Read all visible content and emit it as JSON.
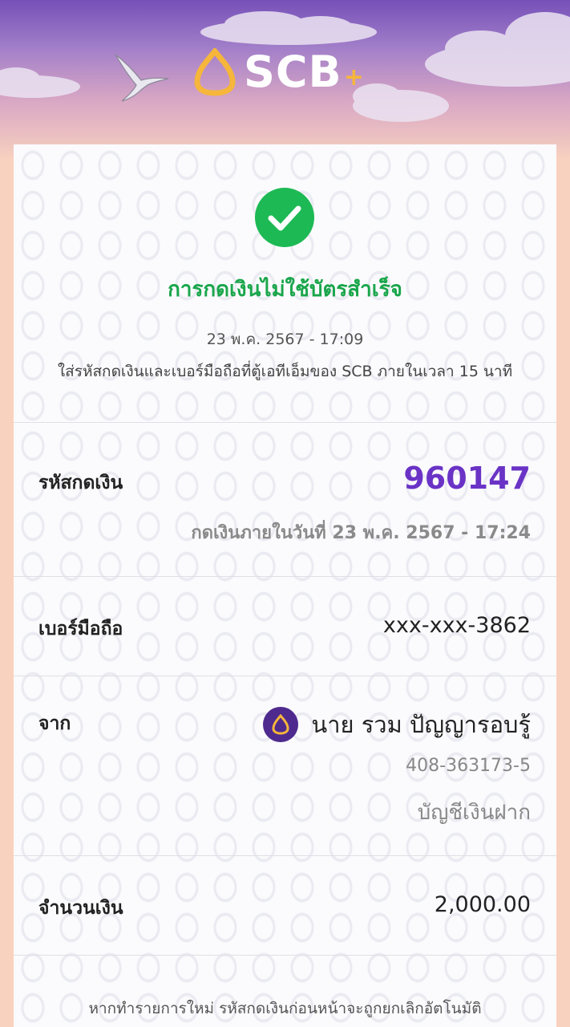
{
  "header": {
    "brand": "SCB",
    "brand_plus": "+",
    "colors": {
      "accent": "#f5b63b",
      "purple": "#6a33c6",
      "success": "#1db954"
    }
  },
  "status": {
    "icon": "checkmark-icon",
    "title": "การกดเงินไม่ใช้บัตรสำเร็จ",
    "datetime": "23 พ.ค. 2567 - 17:09",
    "instruction": "ใส่รหัสกดเงินและเบอร์มือถือที่ตู้เอทีเอ็มของ SCB ภายในเวลา 15 นาที"
  },
  "withdrawal_code": {
    "label": "รหัสกดเงิน",
    "value": "960147",
    "expiry": "กดเงินภายในวันที่ 23 พ.ค. 2567 - 17:24"
  },
  "phone": {
    "label": "เบอร์มือถือ",
    "value": "xxx-xxx-3862"
  },
  "from": {
    "label": "จาก",
    "name": "นาย รวม ปัญญารอบรู้",
    "account_number": "408-363173-5",
    "account_type": "บัญชีเงินฝาก"
  },
  "amount": {
    "label": "จำนวนเงิน",
    "value": "2,000.00"
  },
  "footer": {
    "note": "หากทำรายการใหม่ รหัสกดเงินก่อนหน้าจะถูกยกเลิกอัตโนมัติ"
  }
}
